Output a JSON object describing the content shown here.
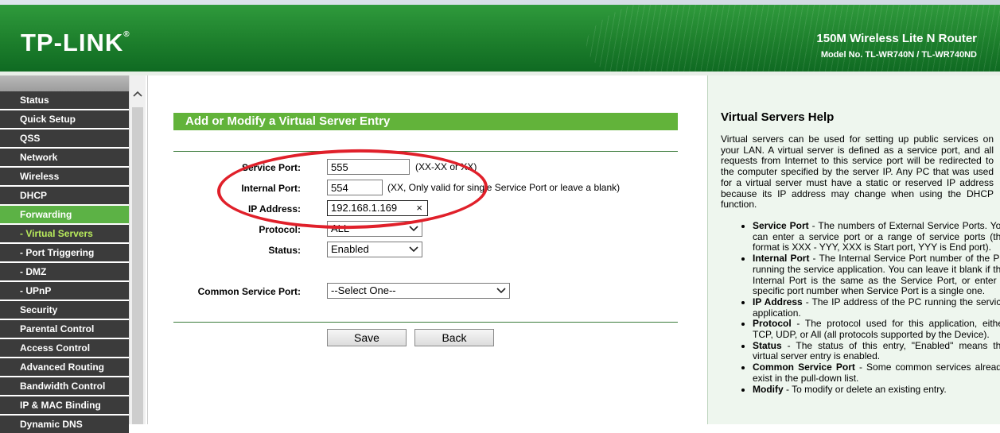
{
  "header": {
    "logo": "TP-LINK",
    "logo_mark": "®",
    "product_title": "150M Wireless Lite N Router",
    "model": "Model No. TL-WR740N / TL-WR740ND"
  },
  "sidebar": {
    "items": [
      {
        "label": "Status"
      },
      {
        "label": "Quick Setup"
      },
      {
        "label": "QSS"
      },
      {
        "label": "Network"
      },
      {
        "label": "Wireless"
      },
      {
        "label": "DHCP"
      },
      {
        "label": "Forwarding"
      },
      {
        "label": "- Virtual Servers"
      },
      {
        "label": "- Port Triggering"
      },
      {
        "label": "- DMZ"
      },
      {
        "label": "- UPnP"
      },
      {
        "label": "Security"
      },
      {
        "label": "Parental Control"
      },
      {
        "label": "Access Control"
      },
      {
        "label": "Advanced Routing"
      },
      {
        "label": "Bandwidth Control"
      },
      {
        "label": "IP & MAC Binding"
      },
      {
        "label": "Dynamic DNS"
      }
    ]
  },
  "form": {
    "title": "Add or Modify a Virtual Server Entry",
    "service_port_label": "Service Port:",
    "service_port_value": "555",
    "service_port_hint": "(XX-XX or XX)",
    "internal_port_label": "Internal Port:",
    "internal_port_value": "554",
    "internal_port_hint": "(XX, Only valid for single Service Port or leave a blank)",
    "ip_label": "IP Address:",
    "ip_value": "192.168.1.169",
    "ip_clear": "×",
    "protocol_label": "Protocol:",
    "protocol_value": "ALL",
    "status_label": "Status:",
    "status_value": "Enabled",
    "common_label": "Common Service Port:",
    "common_value": "--Select One--",
    "save_label": "Save",
    "back_label": "Back"
  },
  "help": {
    "title": "Virtual Servers Help",
    "intro": "Virtual servers can be used for setting up public services on your LAN. A virtual server is defined as a service port, and all requests from Internet to this service port will be redirected to the computer specified by the server IP. Any PC that was used for a virtual server must have a static or reserved IP address because its IP address may change when using the DHCP function.",
    "items": [
      {
        "term": "Service Port",
        "text": " - The numbers of External Service Ports. You can enter a service port or a range of service ports (the format is XXX - YYY, XXX is Start port, YYY is End port)."
      },
      {
        "term": "Internal Port",
        "text": " - The Internal Service Port number of the PC running the service application. You can leave it blank if the Internal Port is the same as the Service Port, or enter a specific port number when Service Port is a single one."
      },
      {
        "term": "IP Address",
        "text": " - The IP address of the PC running the service application."
      },
      {
        "term": "Protocol",
        "text": " - The protocol used for this application, either TCP, UDP, or All (all protocols supported by the Device)."
      },
      {
        "term": "Status",
        "text": " - The status of this entry, \"Enabled\" means the virtual server entry is enabled."
      },
      {
        "term": "Common Service Port",
        "text": " - Some common services already exist in the pull-down list."
      },
      {
        "term": "Modify",
        "text": " - To modify or delete an existing entry."
      }
    ]
  },
  "colors": {
    "brand_green": "#1d7f2c",
    "menu_active": "#5cb245",
    "annotation_red": "#e0202a"
  }
}
